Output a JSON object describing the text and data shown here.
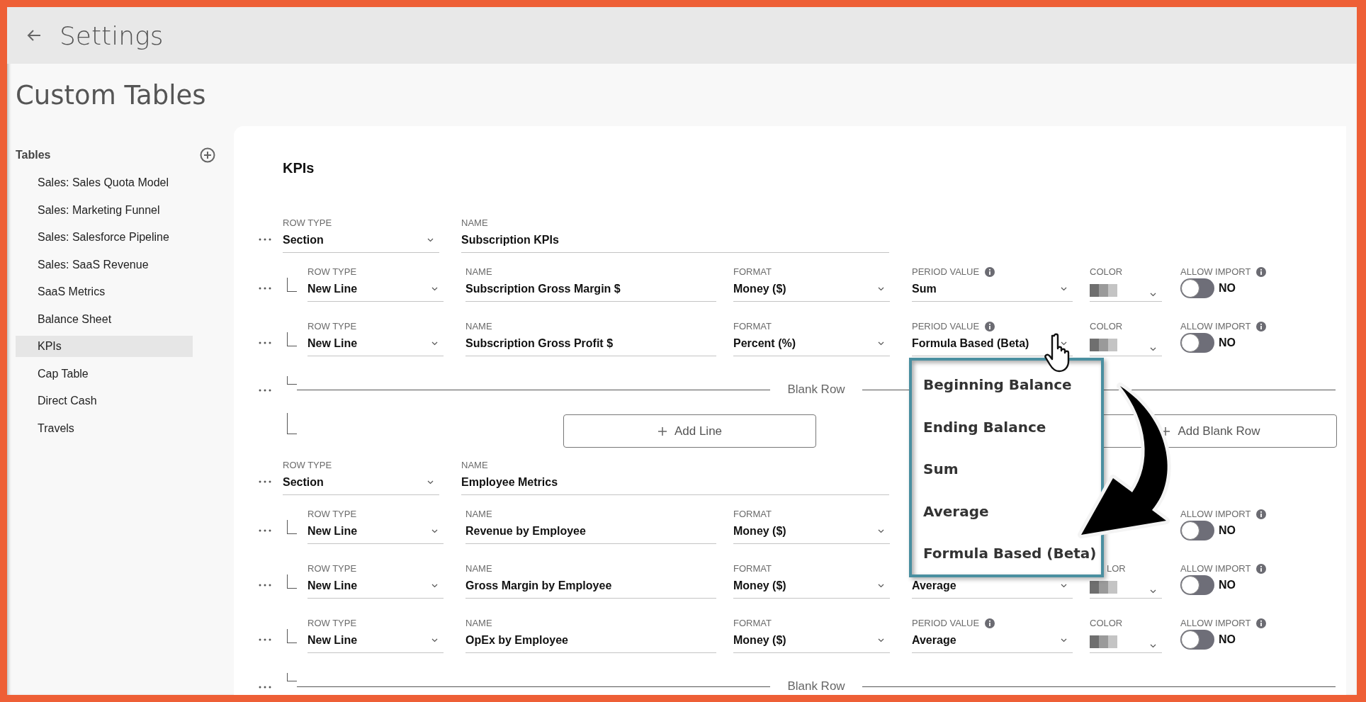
{
  "header": {
    "title": "Settings"
  },
  "page_title": "Custom Tables",
  "sidebar": {
    "heading": "Tables",
    "items": [
      {
        "label": "Sales: Sales Quota Model",
        "selected": false
      },
      {
        "label": "Sales: Marketing Funnel",
        "selected": false
      },
      {
        "label": "Sales: Salesforce Pipeline",
        "selected": false
      },
      {
        "label": "Sales: SaaS Revenue",
        "selected": false
      },
      {
        "label": "SaaS Metrics",
        "selected": false
      },
      {
        "label": "Balance Sheet",
        "selected": false
      },
      {
        "label": "KPIs",
        "selected": true
      },
      {
        "label": "Cap Table",
        "selected": false
      },
      {
        "label": "Direct Cash",
        "selected": false
      },
      {
        "label": "Travels",
        "selected": false
      }
    ]
  },
  "table": {
    "title": "KPIs",
    "rows": [
      {
        "kind": "section",
        "row_type_label": "ROW TYPE",
        "row_type": "Section",
        "name_label": "NAME",
        "name": "Subscription KPIs"
      },
      {
        "kind": "line",
        "row_type_label": "ROW TYPE",
        "row_type": "New Line",
        "name_label": "NAME",
        "name": "Subscription Gross Margin $",
        "format_label": "FORMAT",
        "format": "Money ($)",
        "period": {
          "label": "PERIOD VALUE",
          "value": "Sum"
        },
        "color": {
          "label": "COLOR",
          "covered": false
        },
        "import": {
          "label": "ALLOW IMPORT",
          "on": false,
          "state": "NO"
        }
      },
      {
        "kind": "line",
        "row_type_label": "ROW TYPE",
        "row_type": "New Line",
        "name_label": "NAME",
        "name": "Subscription Gross Profit $",
        "format_label": "FORMAT",
        "format": "Percent (%)",
        "period": {
          "label": "PERIOD VALUE",
          "value": "Formula Based (Beta)"
        },
        "color": {
          "label": "COLOR",
          "covered": false
        },
        "import": {
          "label": "ALLOW IMPORT",
          "on": false,
          "state": "NO"
        }
      },
      {
        "kind": "blank",
        "label": "Blank Row"
      },
      {
        "kind": "add",
        "buttons": [
          "Add Line",
          "Add Blank Row"
        ]
      },
      {
        "kind": "section",
        "row_type_label": "ROW TYPE",
        "row_type": "Section",
        "name_label": "NAME",
        "name": "Employee Metrics"
      },
      {
        "kind": "line",
        "row_type_label": "ROW TYPE",
        "row_type": "New Line",
        "name_label": "NAME",
        "name": "Revenue by Employee",
        "format_label": "FORMAT",
        "format": "Money ($)",
        "import": {
          "label": "ALLOW IMPORT",
          "on": false,
          "state": "NO"
        }
      },
      {
        "kind": "line",
        "row_type_label": "ROW TYPE",
        "row_type": "New Line",
        "name_label": "NAME",
        "name": "Gross Margin by Employee",
        "format_label": "FORMAT",
        "format": "Money ($)",
        "period": {
          "value": "Average"
        },
        "color": {
          "label": "LOR",
          "covered": true
        },
        "import": {
          "label": "ALLOW IMPORT",
          "on": false,
          "state": "NO"
        }
      },
      {
        "kind": "line",
        "row_type_label": "ROW TYPE",
        "row_type": "New Line",
        "name_label": "NAME",
        "name": "OpEx by Employee",
        "format_label": "FORMAT",
        "format": "Money ($)",
        "period": {
          "label": "PERIOD VALUE",
          "value": "Average"
        },
        "color": {
          "label": "COLOR",
          "covered": false
        },
        "import": {
          "label": "ALLOW IMPORT",
          "on": false,
          "state": "NO"
        }
      },
      {
        "kind": "blank",
        "label": "Blank Row"
      }
    ]
  },
  "period_menu": {
    "options": [
      "Beginning Balance",
      "Ending Balance",
      "Sum",
      "Average",
      "Formula Based (Beta)"
    ]
  }
}
